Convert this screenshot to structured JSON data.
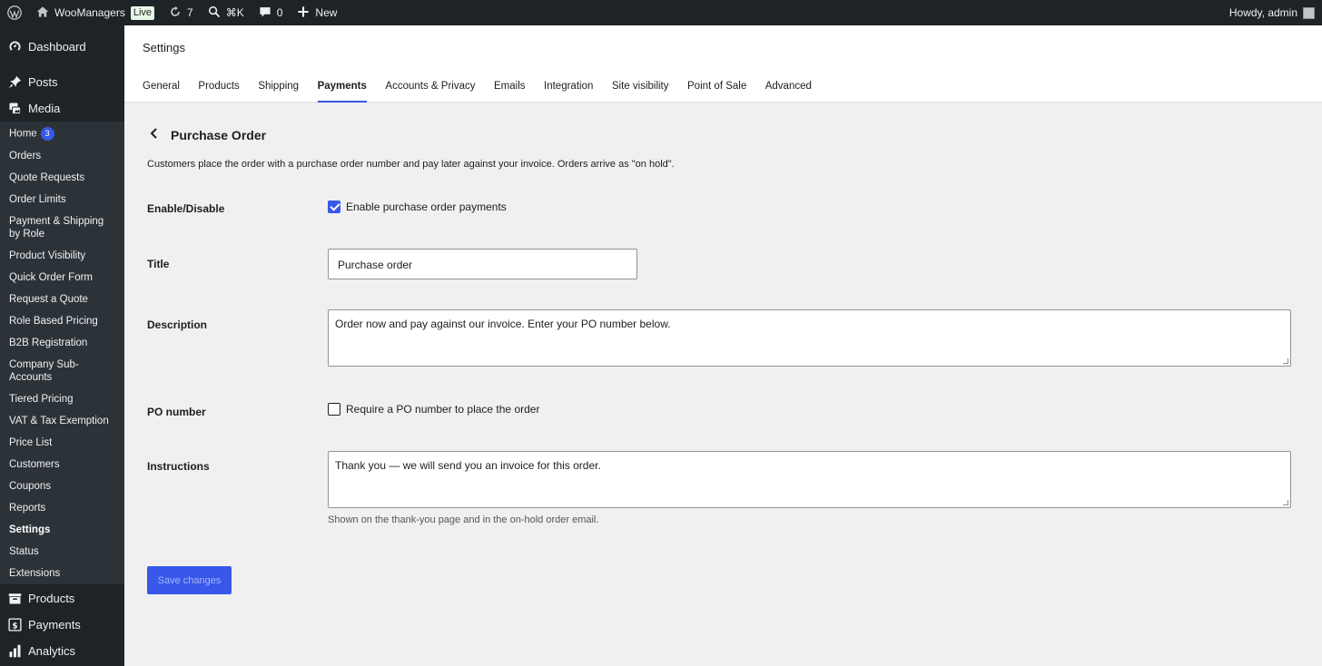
{
  "adminbar": {
    "site_name": "WooManagers",
    "live_badge": "Live",
    "updates_count": "7",
    "search_shortcut": "⌘K",
    "comments_count": "0",
    "new_label": "New",
    "greeting": "Howdy, admin"
  },
  "sidebar": {
    "dashboard": "Dashboard",
    "posts": "Posts",
    "media": "Media",
    "woo_items": [
      {
        "label": "Home",
        "badge": "3"
      },
      {
        "label": "Orders"
      },
      {
        "label": "Quote Requests"
      },
      {
        "label": "Order Limits"
      },
      {
        "label": "Payment & Shipping by Role"
      },
      {
        "label": "Product Visibility"
      },
      {
        "label": "Quick Order Form"
      },
      {
        "label": "Request a Quote"
      },
      {
        "label": "Role Based Pricing"
      },
      {
        "label": "B2B Registration"
      },
      {
        "label": "Company Sub-Accounts"
      },
      {
        "label": "Tiered Pricing"
      },
      {
        "label": "VAT & Tax Exemption"
      },
      {
        "label": "Price List"
      },
      {
        "label": "Customers"
      },
      {
        "label": "Coupons"
      },
      {
        "label": "Reports"
      },
      {
        "label": "Settings"
      },
      {
        "label": "Status"
      },
      {
        "label": "Extensions"
      }
    ],
    "products": "Products",
    "payments": "Payments",
    "analytics": "Analytics"
  },
  "header": {
    "title": "Settings",
    "tabs": [
      "General",
      "Products",
      "Shipping",
      "Payments",
      "Accounts & Privacy",
      "Emails",
      "Integration",
      "Site visibility",
      "Point of Sale",
      "Advanced"
    ],
    "active_tab": "Payments"
  },
  "form": {
    "section_title": "Purchase Order",
    "section_desc": "Customers place the order with a purchase order number and pay later against your invoice. Orders arrive as \"on hold\".",
    "enable": {
      "label": "Enable/Disable",
      "checkbox_label": "Enable purchase order payments",
      "checked": true
    },
    "title": {
      "label": "Title",
      "value": "Purchase order"
    },
    "description": {
      "label": "Description",
      "value": "Order now and pay against our invoice. Enter your PO number below."
    },
    "po_number": {
      "label": "PO number",
      "checkbox_label": "Require a PO number to place the order",
      "checked": false
    },
    "instructions": {
      "label": "Instructions",
      "value": "Thank you — we will send you an invoice for this order.",
      "help": "Shown on the thank-you page and in the on-hold order email."
    },
    "save_label": "Save changes"
  },
  "colors": {
    "accent": "#3858e9",
    "admin_bar": "#1d2327",
    "submenu": "#2c3338"
  }
}
